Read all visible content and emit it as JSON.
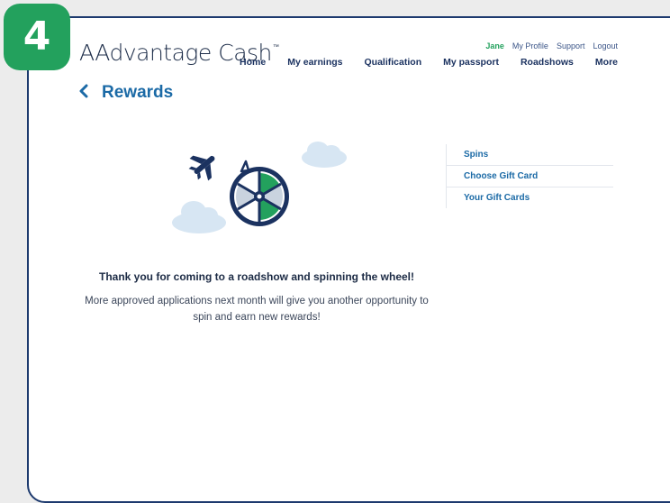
{
  "step_badge": "4",
  "brand": {
    "name": "AAdvantage Cash",
    "tm": "™"
  },
  "util_nav": {
    "user": "Jane",
    "my_profile": "My Profile",
    "support": "Support",
    "logout": "Logout"
  },
  "main_nav": [
    "Home",
    "My earnings",
    "Qualification",
    "My passport",
    "Roadshows",
    "More"
  ],
  "page": {
    "back": "‹",
    "title": "Rewards"
  },
  "message": {
    "headline": "Thank you for coming to a roadshow and spinning the wheel!",
    "body": "More approved applications next month will give you another opportunity to spin and earn new rewards!"
  },
  "side_menu": [
    "Spins",
    "Choose Gift Card",
    "Your Gift Cards"
  ],
  "colors": {
    "accent_green": "#23a15d",
    "brand_blue": "#1b6aa6",
    "nav_navy": "#1b3260"
  }
}
